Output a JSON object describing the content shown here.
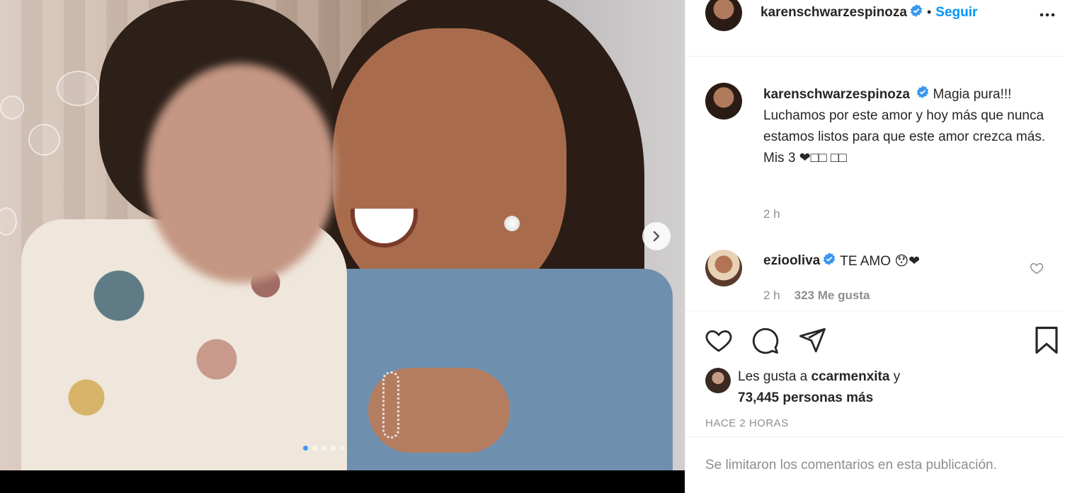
{
  "post": {
    "author": "karenschwarzespinoza",
    "follow_label": "Seguir",
    "separator": "•",
    "more_icon": "more-horizontal-icon"
  },
  "caption": {
    "author": "karenschwarzespinoza",
    "text": "Magia pura!!! Luchamos por este amor y hoy más que nunca estamos listos para que este amor crezca más. Mis 3 ❤□□ □□",
    "time": "2 h"
  },
  "comments": [
    {
      "author": "ezioolivа",
      "text": "TE AMO 😯❤",
      "time": "2 h",
      "likes": "323 Me gusta"
    }
  ],
  "likes": {
    "prefix": "Les gusta a ",
    "user": "ccarmenxita",
    "suffix": " y",
    "count": "73,445 personas más"
  },
  "post_time": "HACE 2 HORAS",
  "footer_text": "Se limitaron los comentarios en esta publicación.",
  "carousel": {
    "slide_count": 5,
    "active_index": 0
  },
  "colors": {
    "accent": "#0095f6",
    "verified": "#3897f0",
    "muted": "#8e8e8e"
  }
}
